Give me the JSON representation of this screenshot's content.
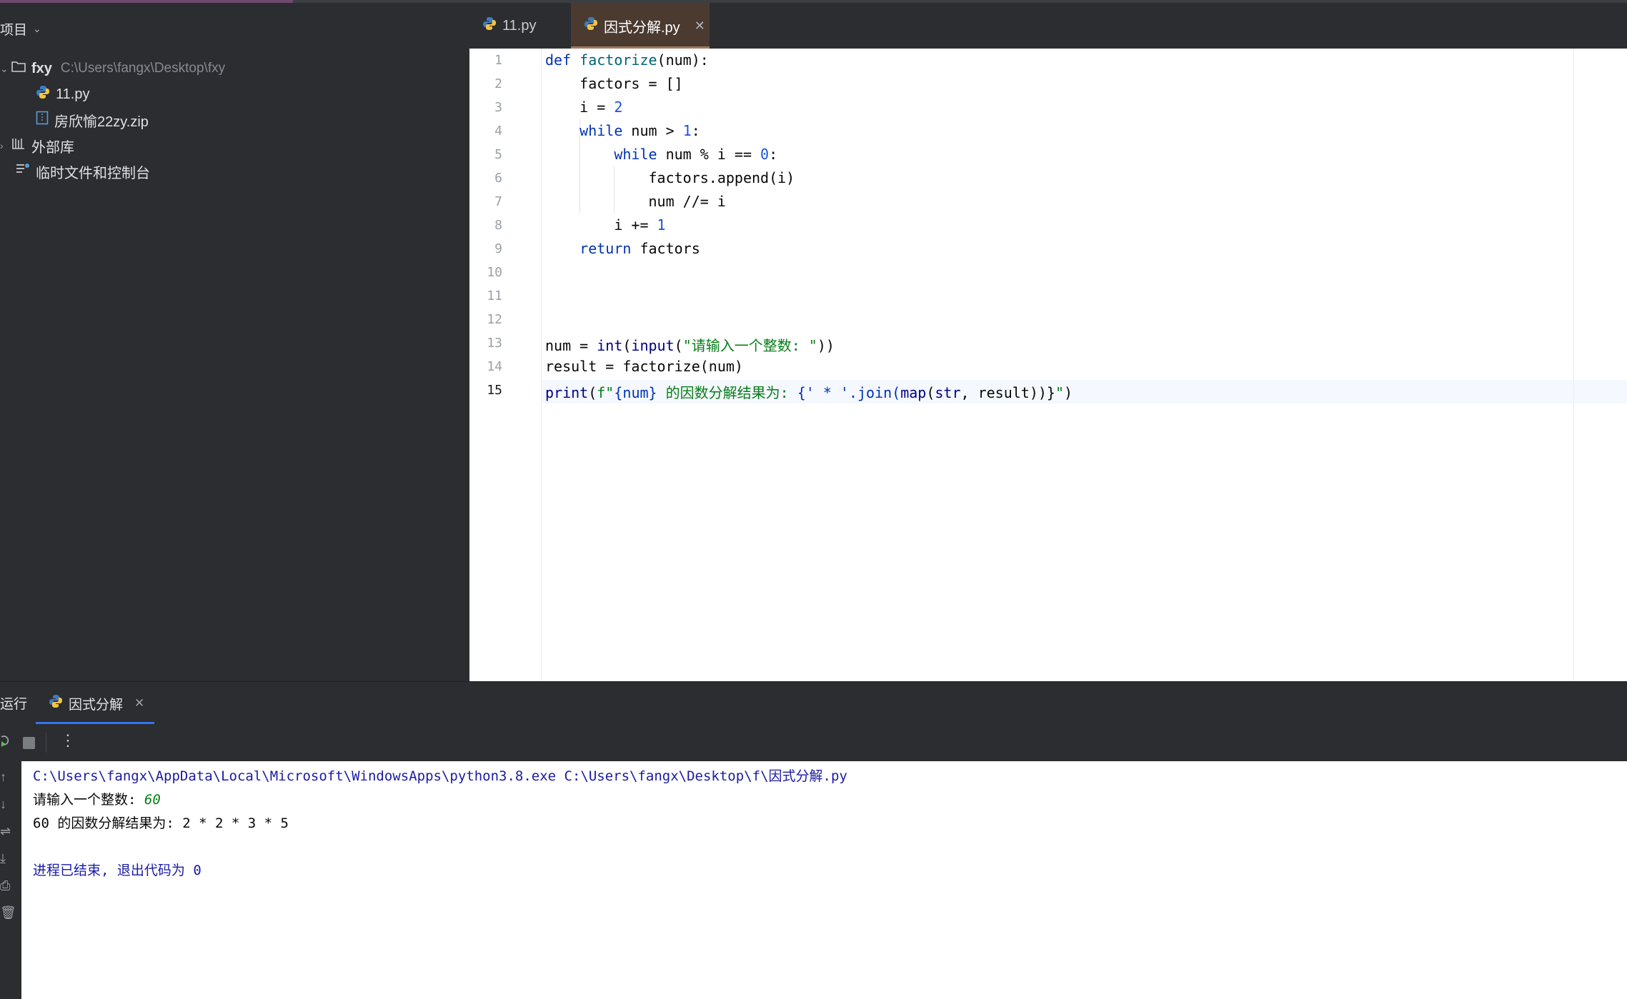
{
  "project": {
    "header": "项目",
    "root_name": "fxy",
    "root_path": "C:\\Users\\fangx\\Desktop\\fxy",
    "file1": "11.py",
    "file2": "房欣愉22zy.zip",
    "ext_libs": "外部库",
    "scratches": "临时文件和控制台"
  },
  "tabs": [
    {
      "label": "11.py"
    },
    {
      "label": "因式分解.py"
    }
  ],
  "line_numbers": [
    "1",
    "2",
    "3",
    "4",
    "5",
    "6",
    "7",
    "8",
    "9",
    "10",
    "11",
    "12",
    "13",
    "14",
    "15"
  ],
  "code": {
    "l1": {
      "def": "def",
      "name": "factorize",
      "rest": "(num):"
    },
    "l2": "    factors = []",
    "l3": {
      "pre": "    i = ",
      "num": "2"
    },
    "l4": {
      "pre": "    ",
      "kw": "while",
      "mid": " num > ",
      "num": "1",
      "end": ":"
    },
    "l5": {
      "pre": "        ",
      "kw": "while",
      "mid": " num % i == ",
      "num": "0",
      "end": ":"
    },
    "l6": "            factors.append(i)",
    "l7": "            num //= i",
    "l8": {
      "pre": "        i += ",
      "num": "1"
    },
    "l9": {
      "pre": "    ",
      "kw": "return",
      "rest": " factors"
    },
    "l12": {
      "pre": "num = ",
      "b1": "int",
      "p1": "(",
      "b2": "input",
      "p2": "(",
      "str": "\"请输入一个整数: \"",
      "end": "))"
    },
    "l13": "result = factorize(num)",
    "l14": {
      "b1": "print",
      "p1": "(",
      "s1": "f\"",
      "e1": "{num}",
      "s2": " 的因数分解结果为: ",
      "e2": "{' * '.join(",
      "b2": "map",
      "p2": "(",
      "b3": "str",
      "rest": ", result))}",
      "s3": "\"",
      "end": ")"
    }
  },
  "run": {
    "title": "运行",
    "tab_label": "因式分解",
    "menu_dots": "⋮"
  },
  "console": {
    "cmd": "C:\\Users\\fangx\\AppData\\Local\\Microsoft\\WindowsApps\\python3.8.exe C:\\Users\\fangx\\Desktop\\f\\因式分解.py",
    "prompt": "请输入一个整数: ",
    "input": "60",
    "result": "60 的因数分解结果为: 2 * 2 * 3 * 5",
    "exit": "进程已结束, 退出代码为 0"
  }
}
